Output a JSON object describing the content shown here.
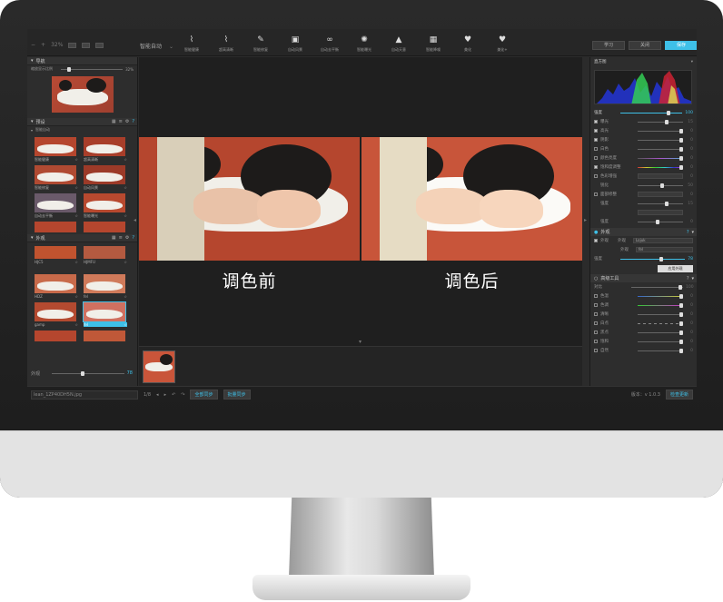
{
  "app": {
    "zoom": "32%",
    "preset": "智能自动",
    "tabs": [
      {
        "label": "学习",
        "active": false
      },
      {
        "label": "关闭",
        "active": false
      },
      {
        "label": "保存",
        "active": true
      }
    ]
  },
  "toolbar": [
    {
      "label": "智能健康",
      "icon": "brush-icon"
    },
    {
      "label": "超高清晰",
      "icon": "sharpen-icon"
    },
    {
      "label": "智能修复",
      "icon": "pen-icon"
    },
    {
      "label": "自动风景",
      "icon": "landscape-icon"
    },
    {
      "label": "自动去平衡",
      "icon": "glasses-icon"
    },
    {
      "label": "智能曝光",
      "icon": "aperture-icon"
    },
    {
      "label": "自动天意",
      "icon": "mountain-icon"
    },
    {
      "label": "智能降噪",
      "icon": "noise-icon"
    },
    {
      "label": "美化",
      "icon": "heart-icon"
    },
    {
      "label": "美化+",
      "icon": "heart-plus-icon"
    }
  ],
  "left": {
    "navigator_title": "导航",
    "navigator_label": "缩放显示比例",
    "navigator_value": "32%",
    "presets_title": "预设",
    "presets_group": "智能自动",
    "presets": [
      "智能健康",
      "超高清晰",
      "智能修复",
      "自动风景",
      "自动去平衡",
      "智能曝光",
      "",
      ""
    ],
    "effects_title": "外观",
    "effects": [
      "HJC5",
      "HJMFU",
      "HDZ",
      "fel",
      "gamp",
      "fel",
      "",
      ""
    ],
    "strength_label": "外观",
    "strength_value": "78"
  },
  "center": {
    "before_label": "调色前",
    "after_label": "调色后"
  },
  "status": {
    "file": "lean_1ZP40DH5N.jpg",
    "count": "1/8",
    "btn_sync": "全部同步",
    "btn_batch": "批量同步",
    "version": "版本：v 1.0.3",
    "update": "检查更新"
  },
  "right": {
    "histogram_title": "直方图",
    "tone_title": "强度",
    "tone_value": "100",
    "rows": [
      {
        "label": "曝光",
        "checked": true,
        "value": "15"
      },
      {
        "label": "高光",
        "checked": true,
        "value": "0"
      },
      {
        "label": "阴影",
        "checked": true,
        "value": "0"
      },
      {
        "label": "白色",
        "checked": false,
        "value": "0"
      },
      {
        "label": "颜色亮度",
        "checked": false,
        "value": "0"
      },
      {
        "label": "饱和度调整",
        "checked": true,
        "value": "0"
      },
      {
        "label": "色彩增强",
        "checked": false,
        "value": "0"
      },
      {
        "label": "锐化",
        "checked": false,
        "value": "50"
      },
      {
        "label": "面部修整",
        "checked": false,
        "value": "0"
      },
      {
        "label": "强度",
        "checked": false,
        "value": "15"
      },
      {
        "label": "",
        "checked": false,
        "value": ""
      },
      {
        "label": "强度",
        "checked": false,
        "value": "0"
      }
    ],
    "look_title": "外观",
    "look_enable": "外观",
    "look_name_label": "外观",
    "look_name": "Lojuk",
    "look_style_label": "外观",
    "look_style": "fel",
    "look_strength_label": "强度",
    "look_strength_value": "78",
    "look_button": "应用外观",
    "adv_title": "高级工具",
    "adv_rows": [
      {
        "label": "对比",
        "value": "100"
      },
      {
        "label": "色温",
        "value": "0"
      },
      {
        "label": "色调",
        "value": "0"
      },
      {
        "label": "清晰",
        "value": "0"
      },
      {
        "label": "白点",
        "value": "0"
      },
      {
        "label": "黑点",
        "value": "0"
      },
      {
        "label": "饱和",
        "value": "0"
      },
      {
        "label": "自然",
        "value": "0"
      }
    ]
  }
}
